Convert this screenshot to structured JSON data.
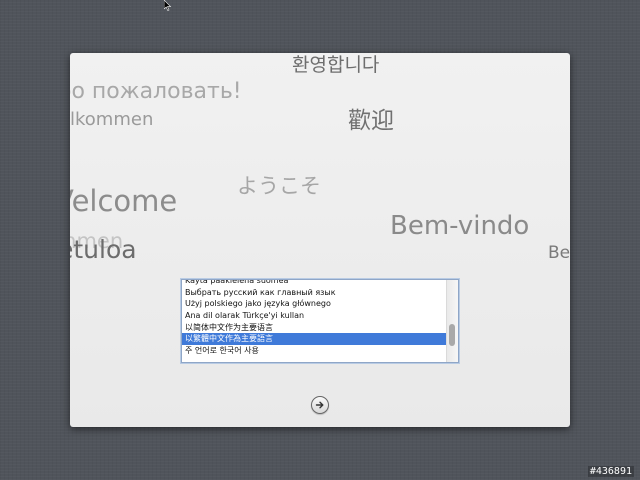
{
  "welcome_words": {
    "korean": "환영합니다",
    "russian": "оо пожаловать!",
    "german_1": "llkommen",
    "chinese": "歡迎",
    "japanese": "ようこそ",
    "english": "Velcome",
    "german_2": "mmen",
    "finnish": "etuloa",
    "portuguese": "Bem-vindo",
    "portuguese_partial": "Be"
  },
  "language_list": {
    "items": [
      "Käytä pääkieienä suomea",
      "Выбрать русский как главный язык",
      "Użyj polskiego jako języka głównego",
      "Ana dil olarak Türkçe'yi kullan",
      "以简体中文作为主要语言",
      "以繁體中文作為主要語言",
      "주 언어로 한국어 사용"
    ],
    "selected_index": 5
  },
  "continue_button": {
    "icon": "arrow-right-icon"
  },
  "watermark": "#436891",
  "colors": {
    "desktop_bg": "#50545b",
    "panel_bg": "#efefef",
    "selection": "#3f7ad9"
  }
}
